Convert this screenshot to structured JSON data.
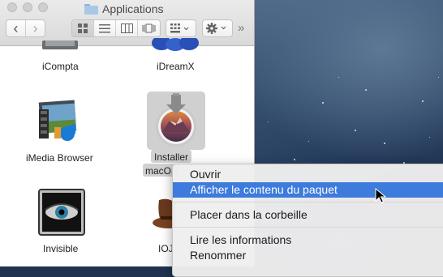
{
  "window": {
    "title": "Applications"
  },
  "toolbar": {
    "back_glyph": "‹",
    "forward_glyph": "›",
    "overflow_glyph": "»"
  },
  "items": [
    {
      "name": "iCompta",
      "icon": "icompta-icon"
    },
    {
      "name": "iDreamX",
      "icon": "idreamx-icon"
    },
    {
      "name": "iMedia Browser",
      "icon": "imedia-browser-icon"
    },
    {
      "name_line1": "Installer",
      "name_line2": "macOS",
      "icon": "installer-macos-icon",
      "selected": true
    },
    {
      "name": "Invisible",
      "icon": "invisible-icon"
    },
    {
      "name": "IOJ",
      "icon": "ioj-icon"
    }
  ],
  "context_menu": {
    "items": [
      {
        "label": "Ouvrir"
      },
      {
        "label": "Afficher le contenu du paquet",
        "highlighted": true
      },
      {
        "label": "Placer dans la corbeille"
      },
      {
        "label": "Lire les informations"
      },
      {
        "label": "Renommer"
      }
    ]
  },
  "colors": {
    "menu_highlight": "#3d7bdc",
    "selection_bg": "#d0d0d0"
  }
}
